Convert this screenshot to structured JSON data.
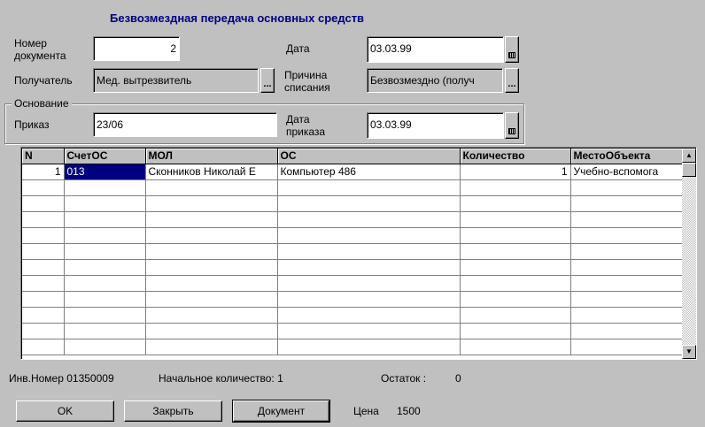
{
  "form": {
    "title": "Безвозмездная передача основных средств",
    "doc_number_label_1": "Номер",
    "doc_number_label_2": "документа",
    "doc_number": "2",
    "date_label": "Дата",
    "date": "03.03.99",
    "recipient_label": "Получатель",
    "recipient": "Мед. вытрезвитель",
    "reason_label_1": "Причина",
    "reason_label_2": "списания",
    "reason": "Безвозмездно (получ",
    "basis_group_label": "Основание",
    "order_label": "Приказ",
    "order": "23/06",
    "order_date_label_1": "Дата",
    "order_date_label_2": "приказа",
    "order_date": "03.03.99"
  },
  "grid": {
    "columns": [
      "N",
      "СчетОС",
      "МОЛ",
      "ОС",
      "Количество",
      "МестоОбъекта"
    ],
    "rows": [
      [
        "1",
        "013",
        "Сконников Николай Е",
        "Компьютер 486",
        "1",
        "Учебно-вспомога"
      ]
    ],
    "empty_rows": 11
  },
  "footer": {
    "inv_number": "Инв.Номер 01350009",
    "initial_qty": "Начальное количество: 1",
    "remain_label": "Остаток :",
    "remain_value": "0",
    "price_label": "Цена",
    "price_value": "1500"
  },
  "buttons": {
    "ok": "OK",
    "close": "Закрыть",
    "document": "Документ"
  }
}
